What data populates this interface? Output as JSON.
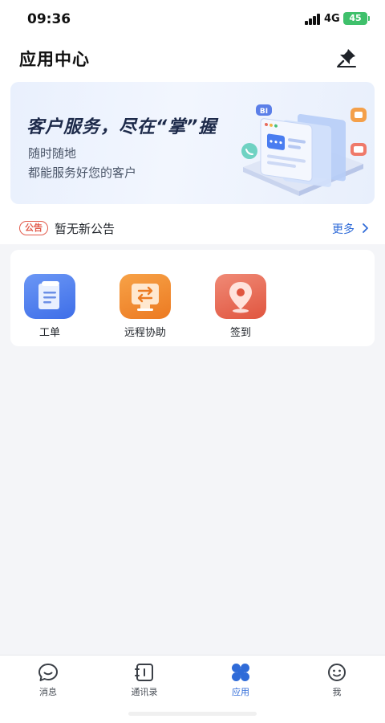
{
  "status_bar": {
    "time": "09:36",
    "network": "4G",
    "battery": "45"
  },
  "header": {
    "title": "应用中心",
    "pin_icon": "pin-icon"
  },
  "banner": {
    "headline": "客户服务，尽在“掌”握",
    "sub_line1": "随时随地",
    "sub_line2": "都能服务好您的客户",
    "art_badge": "BI"
  },
  "notice": {
    "badge": "公告",
    "text": "暂无新公告",
    "more": "更多"
  },
  "apps": [
    {
      "label": "工单",
      "icon": "work-order-icon",
      "color": "#4a7df0"
    },
    {
      "label": "远程协助",
      "icon": "remote-assist-icon",
      "color": "#f08a2c"
    },
    {
      "label": "签到",
      "icon": "check-in-icon",
      "color": "#e8614c"
    }
  ],
  "tabs": [
    {
      "label": "消息",
      "icon": "message-icon"
    },
    {
      "label": "通讯录",
      "icon": "contacts-icon"
    },
    {
      "label": "应用",
      "icon": "apps-icon",
      "active": true
    },
    {
      "label": "我",
      "icon": "profile-icon"
    }
  ],
  "colors": {
    "accent": "#2f6bd8",
    "notice_badge": "#e25b4c",
    "battery": "#3fc06b"
  }
}
